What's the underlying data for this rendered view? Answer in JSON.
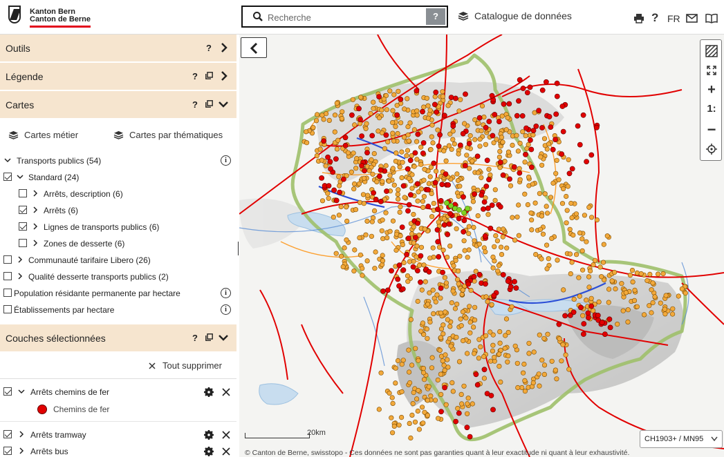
{
  "header": {
    "logo_line1": "Kanton Bern",
    "logo_line2": "Canton de Berne",
    "search_placeholder": "Recherche",
    "search_help": "?",
    "catalog_label": "Catalogue de données",
    "lang": "FR",
    "icons": [
      "print-icon",
      "help-icon",
      "mail-icon",
      "book-icon"
    ]
  },
  "panel": {
    "sections": {
      "outils": "Outils",
      "legende": "Légende",
      "cartes": "Cartes",
      "couches": "Couches sélectionnées"
    },
    "help_q": "?",
    "tabs": {
      "metier": "Cartes métier",
      "thematiques": "Cartes par thématiques"
    },
    "tree": [
      {
        "label": "Transports publics (54)"
      },
      {
        "label": "Standard (24)"
      },
      {
        "label": "Arrêts, description (6)"
      },
      {
        "label": "Arrêts (6)"
      },
      {
        "label": "Lignes de transports publics (6)"
      },
      {
        "label": "Zones de desserte (6)"
      },
      {
        "label": "Communauté tarifaire Libero (26)"
      },
      {
        "label": "Qualité desserte transports publics (2)"
      },
      {
        "label": "Population résidante permanente par hectare"
      },
      {
        "label": "Établissements par hectare"
      }
    ],
    "clear_all": "Tout supprimer",
    "layers": [
      {
        "label": "Arrêts chemins de fer",
        "legend_item": "Chemins de fer",
        "legend_color": "#e10000"
      },
      {
        "label": "Arrêts tramway"
      },
      {
        "label": "Arrêts bus"
      }
    ]
  },
  "map": {
    "scale_label": "20km",
    "crs": "CH1903+ / MN95",
    "copyright": "© Canton de Berne, swisstopo - Ces données ne sont pas garanties quant à leur exactitude ni quant à leur exhaustivité.",
    "zoom_ratio_label": "1:",
    "colors": {
      "railway": "#e10000",
      "bus_stop": "#f2a93b",
      "tram": "#2c4fd6",
      "boundary": "#9fc06a",
      "lake": "#c8ddef"
    }
  }
}
